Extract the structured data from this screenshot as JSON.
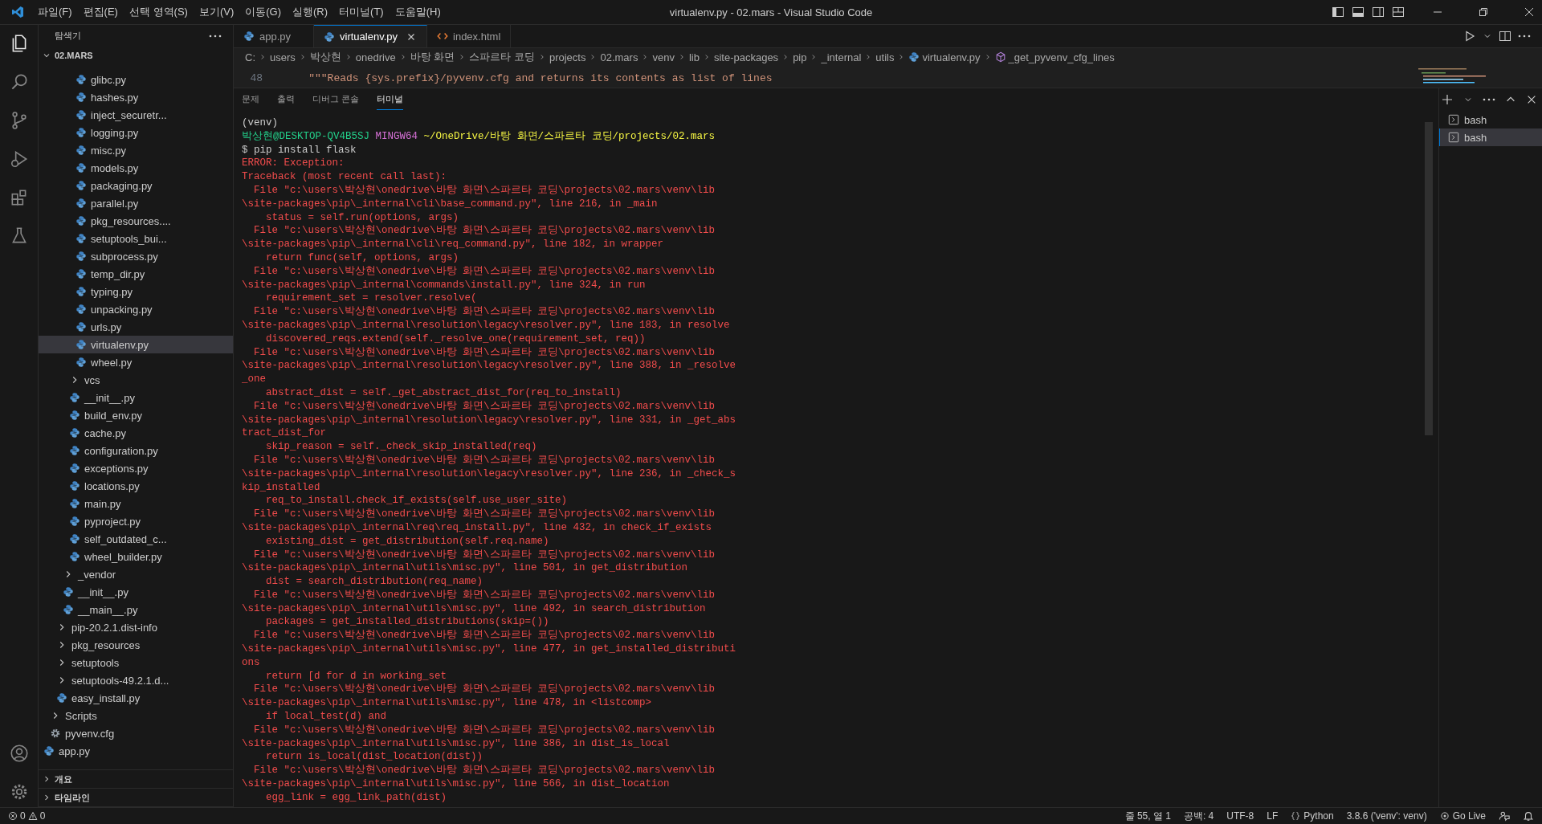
{
  "window": {
    "title": "virtualenv.py - 02.mars - Visual Studio Code"
  },
  "menu": [
    "파일(F)",
    "편집(E)",
    "선택 영역(S)",
    "보기(V)",
    "이동(G)",
    "실행(R)",
    "터미널(T)",
    "도움말(H)"
  ],
  "sidebar": {
    "title": "탐색기",
    "section": "02.MARS",
    "tree": [
      {
        "children": [
          {
            "children": [
              {
                "children": [
                  {
                    "children": [
                      {
                        "children": [
                          {
                            "label": "glibc.py",
                            "kind": "py",
                            "selected": false
                          },
                          {
                            "label": "hashes.py",
                            "kind": "py",
                            "selected": false
                          },
                          {
                            "label": "inject_securetr...",
                            "kind": "py",
                            "selected": false
                          },
                          {
                            "label": "logging.py",
                            "kind": "py",
                            "selected": false
                          },
                          {
                            "label": "misc.py",
                            "kind": "py",
                            "selected": false
                          },
                          {
                            "label": "models.py",
                            "kind": "py",
                            "selected": false
                          },
                          {
                            "label": "packaging.py",
                            "kind": "py",
                            "selected": false
                          },
                          {
                            "label": "parallel.py",
                            "kind": "py",
                            "selected": false
                          },
                          {
                            "label": "pkg_resources....",
                            "kind": "py",
                            "selected": false
                          },
                          {
                            "label": "setuptools_bui...",
                            "kind": "py",
                            "selected": false
                          },
                          {
                            "label": "subprocess.py",
                            "kind": "py",
                            "selected": false
                          },
                          {
                            "label": "temp_dir.py",
                            "kind": "py",
                            "selected": false
                          },
                          {
                            "label": "typing.py",
                            "kind": "py",
                            "selected": false
                          },
                          {
                            "label": "unpacking.py",
                            "kind": "py",
                            "selected": false
                          },
                          {
                            "label": "urls.py",
                            "kind": "py",
                            "selected": false
                          },
                          {
                            "label": "virtualenv.py",
                            "kind": "py",
                            "selected": true
                          },
                          {
                            "label": "wheel.py",
                            "kind": "py",
                            "selected": false
                          }
                        ]
                      },
                      {
                        "label": "vcs",
                        "kind": "folder",
                        "selected": false,
                        "expanded": false
                      },
                      {
                        "label": "__init__.py",
                        "kind": "py",
                        "selected": false
                      },
                      {
                        "label": "build_env.py",
                        "kind": "py",
                        "selected": false
                      },
                      {
                        "label": "cache.py",
                        "kind": "py",
                        "selected": false
                      },
                      {
                        "label": "configuration.py",
                        "kind": "py",
                        "selected": false
                      },
                      {
                        "label": "exceptions.py",
                        "kind": "py",
                        "selected": false
                      },
                      {
                        "label": "locations.py",
                        "kind": "py",
                        "selected": false
                      },
                      {
                        "label": "main.py",
                        "kind": "py",
                        "selected": false
                      },
                      {
                        "label": "pyproject.py",
                        "kind": "py",
                        "selected": false
                      },
                      {
                        "label": "self_outdated_c...",
                        "kind": "py",
                        "selected": false
                      },
                      {
                        "label": "wheel_builder.py",
                        "kind": "py",
                        "selected": false
                      }
                    ]
                  },
                  {
                    "label": "_vendor",
                    "kind": "folder",
                    "selected": false,
                    "expanded": false
                  },
                  {
                    "label": "__init__.py",
                    "kind": "py",
                    "selected": false
                  },
                  {
                    "label": "__main__.py",
                    "kind": "py",
                    "selected": false
                  }
                ]
              },
              {
                "label": "pip-20.2.1.dist-info",
                "kind": "folder",
                "selected": false,
                "expanded": false
              },
              {
                "label": "pkg_resources",
                "kind": "folder",
                "selected": false,
                "expanded": false
              },
              {
                "label": "setuptools",
                "kind": "folder",
                "selected": false,
                "expanded": false
              },
              {
                "label": "setuptools-49.2.1.d...",
                "kind": "folder",
                "selected": false,
                "expanded": false
              },
              {
                "label": "easy_install.py",
                "kind": "py",
                "selected": false
              }
            ]
          },
          {
            "label": "Scripts",
            "kind": "folder",
            "selected": false,
            "expanded": false
          },
          {
            "label": "pyvenv.cfg",
            "kind": "cfg",
            "selected": false
          }
        ]
      },
      {
        "label": "app.py",
        "kind": "py",
        "selected": false
      }
    ],
    "bottom_sections": [
      "개요",
      "타임라인"
    ]
  },
  "tabs": [
    {
      "label": "app.py",
      "kind": "py",
      "selected": false
    },
    {
      "label": "virtualenv.py",
      "kind": "py",
      "selected": true
    },
    {
      "label": "index.html",
      "kind": "html",
      "selected": false
    }
  ],
  "breadcrumb": [
    {
      "label": "C:",
      "kind": "text"
    },
    {
      "label": "users",
      "kind": "text"
    },
    {
      "label": "박상현",
      "kind": "text"
    },
    {
      "label": "onedrive",
      "kind": "text"
    },
    {
      "label": "바탕 화면",
      "kind": "text"
    },
    {
      "label": "스파르타 코딩",
      "kind": "text"
    },
    {
      "label": "projects",
      "kind": "text"
    },
    {
      "label": "02.mars",
      "kind": "text"
    },
    {
      "label": "venv",
      "kind": "text"
    },
    {
      "label": "lib",
      "kind": "text"
    },
    {
      "label": "site-packages",
      "kind": "text"
    },
    {
      "label": "pip",
      "kind": "text"
    },
    {
      "label": "_internal",
      "kind": "text"
    },
    {
      "label": "utils",
      "kind": "text"
    },
    {
      "label": "virtualenv.py",
      "kind": "py"
    },
    {
      "label": "_get_pyvenv_cfg_lines",
      "kind": "method"
    }
  ],
  "editor": {
    "lines": [
      {
        "number": "48",
        "text": "    \"\"\"Reads {sys.prefix}/pyvenv.cfg and returns its contents as list of lines"
      }
    ]
  },
  "panel": {
    "tabs": [
      {
        "label": "문제",
        "selected": false
      },
      {
        "label": "출력",
        "selected": false
      },
      {
        "label": "디버그 콘솔",
        "selected": false
      },
      {
        "label": "터미널",
        "selected": true
      }
    ],
    "terminal_lines": [
      {
        "kind": "text",
        "text": "(venv)"
      },
      {
        "kind": "prompt",
        "user": "박상현@DESKTOP-QV4B5SJ",
        "host": "MINGW64",
        "path": "~/OneDrive/바탕 화면/스파르타 코딩/projects/02.mars"
      },
      {
        "kind": "text",
        "text": "$ pip install flask"
      },
      {
        "kind": "error",
        "text": "ERROR: Exception:"
      },
      {
        "kind": "error",
        "text": "Traceback (most recent call last):"
      },
      {
        "kind": "error",
        "text": "  File \"c:\\users\\박상현\\onedrive\\바탕 화면\\스파르타 코딩\\projects\\02.mars\\venv\\lib"
      },
      {
        "kind": "error",
        "text": "\\site-packages\\pip\\_internal\\cli\\base_command.py\", line 216, in _main"
      },
      {
        "kind": "error",
        "text": "    status = self.run(options, args)"
      },
      {
        "kind": "error",
        "text": "  File \"c:\\users\\박상현\\onedrive\\바탕 화면\\스파르타 코딩\\projects\\02.mars\\venv\\lib"
      },
      {
        "kind": "error",
        "text": "\\site-packages\\pip\\_internal\\cli\\req_command.py\", line 182, in wrapper"
      },
      {
        "kind": "error",
        "text": "    return func(self, options, args)"
      },
      {
        "kind": "error",
        "text": "  File \"c:\\users\\박상현\\onedrive\\바탕 화면\\스파르타 코딩\\projects\\02.mars\\venv\\lib"
      },
      {
        "kind": "error",
        "text": "\\site-packages\\pip\\_internal\\commands\\install.py\", line 324, in run"
      },
      {
        "kind": "error",
        "text": "    requirement_set = resolver.resolve("
      },
      {
        "kind": "error",
        "text": "  File \"c:\\users\\박상현\\onedrive\\바탕 화면\\스파르타 코딩\\projects\\02.mars\\venv\\lib"
      },
      {
        "kind": "error",
        "text": "\\site-packages\\pip\\_internal\\resolution\\legacy\\resolver.py\", line 183, in resolve"
      },
      {
        "kind": "error",
        "text": "    discovered_reqs.extend(self._resolve_one(requirement_set, req))"
      },
      {
        "kind": "error",
        "text": "  File \"c:\\users\\박상현\\onedrive\\바탕 화면\\스파르타 코딩\\projects\\02.mars\\venv\\lib"
      },
      {
        "kind": "error",
        "text": "\\site-packages\\pip\\_internal\\resolution\\legacy\\resolver.py\", line 388, in _resolve"
      },
      {
        "kind": "error",
        "text": "_one"
      },
      {
        "kind": "error",
        "text": "    abstract_dist = self._get_abstract_dist_for(req_to_install)"
      },
      {
        "kind": "error",
        "text": "  File \"c:\\users\\박상현\\onedrive\\바탕 화면\\스파르타 코딩\\projects\\02.mars\\venv\\lib"
      },
      {
        "kind": "error",
        "text": "\\site-packages\\pip\\_internal\\resolution\\legacy\\resolver.py\", line 331, in _get_abs"
      },
      {
        "kind": "error",
        "text": "tract_dist_for"
      },
      {
        "kind": "error",
        "text": "    skip_reason = self._check_skip_installed(req)"
      },
      {
        "kind": "error",
        "text": "  File \"c:\\users\\박상현\\onedrive\\바탕 화면\\스파르타 코딩\\projects\\02.mars\\venv\\lib"
      },
      {
        "kind": "error",
        "text": "\\site-packages\\pip\\_internal\\resolution\\legacy\\resolver.py\", line 236, in _check_s"
      },
      {
        "kind": "error",
        "text": "kip_installed"
      },
      {
        "kind": "error",
        "text": "    req_to_install.check_if_exists(self.use_user_site)"
      },
      {
        "kind": "error",
        "text": "  File \"c:\\users\\박상현\\onedrive\\바탕 화면\\스파르타 코딩\\projects\\02.mars\\venv\\lib"
      },
      {
        "kind": "error",
        "text": "\\site-packages\\pip\\_internal\\req\\req_install.py\", line 432, in check_if_exists"
      },
      {
        "kind": "error",
        "text": "    existing_dist = get_distribution(self.req.name)"
      },
      {
        "kind": "error",
        "text": "  File \"c:\\users\\박상현\\onedrive\\바탕 화면\\스파르타 코딩\\projects\\02.mars\\venv\\lib"
      },
      {
        "kind": "error",
        "text": "\\site-packages\\pip\\_internal\\utils\\misc.py\", line 501, in get_distribution"
      },
      {
        "kind": "error",
        "text": "    dist = search_distribution(req_name)"
      },
      {
        "kind": "error",
        "text": "  File \"c:\\users\\박상현\\onedrive\\바탕 화면\\스파르타 코딩\\projects\\02.mars\\venv\\lib"
      },
      {
        "kind": "error",
        "text": "\\site-packages\\pip\\_internal\\utils\\misc.py\", line 492, in search_distribution"
      },
      {
        "kind": "error",
        "text": "    packages = get_installed_distributions(skip=())"
      },
      {
        "kind": "error",
        "text": "  File \"c:\\users\\박상현\\onedrive\\바탕 화면\\스파르타 코딩\\projects\\02.mars\\venv\\lib"
      },
      {
        "kind": "error",
        "text": "\\site-packages\\pip\\_internal\\utils\\misc.py\", line 477, in get_installed_distributi"
      },
      {
        "kind": "error",
        "text": "ons"
      },
      {
        "kind": "error",
        "text": "    return [d for d in working_set"
      },
      {
        "kind": "error",
        "text": "  File \"c:\\users\\박상현\\onedrive\\바탕 화면\\스파르타 코딩\\projects\\02.mars\\venv\\lib"
      },
      {
        "kind": "error",
        "text": "\\site-packages\\pip\\_internal\\utils\\misc.py\", line 478, in <listcomp>"
      },
      {
        "kind": "error",
        "text": "    if local_test(d) and"
      },
      {
        "kind": "error",
        "text": "  File \"c:\\users\\박상현\\onedrive\\바탕 화면\\스파르타 코딩\\projects\\02.mars\\venv\\lib"
      },
      {
        "kind": "error",
        "text": "\\site-packages\\pip\\_internal\\utils\\misc.py\", line 386, in dist_is_local"
      },
      {
        "kind": "error",
        "text": "    return is_local(dist_location(dist))"
      },
      {
        "kind": "error",
        "text": "  File \"c:\\users\\박상현\\onedrive\\바탕 화면\\스파르타 코딩\\projects\\02.mars\\venv\\lib"
      },
      {
        "kind": "error",
        "text": "\\site-packages\\pip\\_internal\\utils\\misc.py\", line 566, in dist_location"
      },
      {
        "kind": "error",
        "text": "    egg_link = egg_link_path(dist)"
      }
    ],
    "terminals": [
      {
        "label": "bash",
        "selected": false
      },
      {
        "label": "bash",
        "selected": true
      }
    ]
  },
  "status_bar": {
    "errors": "0",
    "warnings": "0",
    "items": [
      {
        "kind": "text",
        "text": "줄 55, 열 1"
      },
      {
        "kind": "text",
        "text": "공백: 4"
      },
      {
        "kind": "text",
        "text": "UTF-8"
      },
      {
        "kind": "text",
        "text": "LF"
      },
      {
        "kind": "language",
        "text": "Python"
      },
      {
        "kind": "text",
        "text": "3.8.6 ('venv': venv)"
      },
      {
        "kind": "live",
        "text": "Go Live"
      }
    ]
  }
}
